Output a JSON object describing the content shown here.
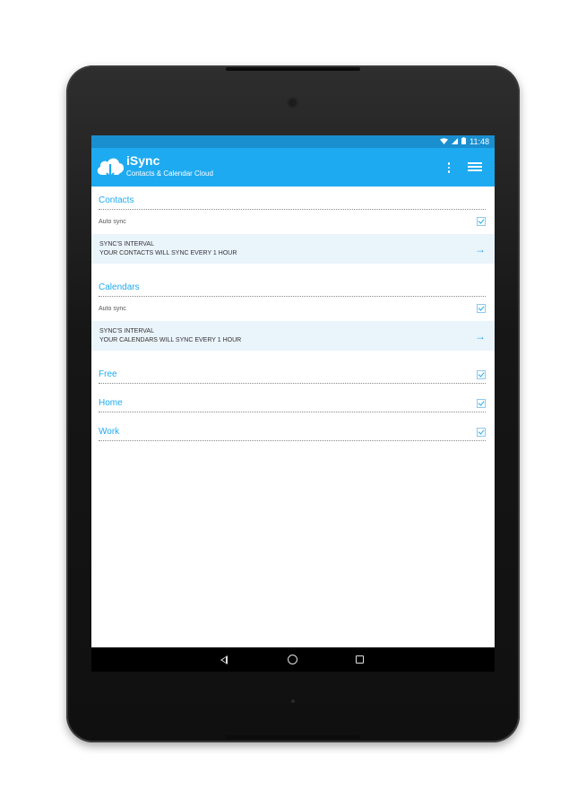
{
  "status_bar": {
    "time": "11:48",
    "icons": [
      "wifi-icon",
      "signal-icon",
      "battery-icon"
    ]
  },
  "app_bar": {
    "title": "iSync",
    "subtitle": "Contacts & Calendar Cloud",
    "logo_icon": "cloud-download-icon",
    "actions": [
      "overflow-menu-icon",
      "hamburger-menu-icon"
    ]
  },
  "contacts": {
    "header": "Contacts",
    "auto_sync_label": "Auto sync",
    "auto_sync_checked": true,
    "interval_title": "SYNC'S INTERVAL",
    "interval_description": "YOUR CONTACTS WILL SYNC EVERY 1 HOUR"
  },
  "calendars": {
    "header": "Calendars",
    "auto_sync_label": "Auto sync",
    "auto_sync_checked": true,
    "interval_title": "SYNC'S INTERVAL",
    "interval_description": "YOUR CALENDARS WILL SYNC EVERY 1 HOUR"
  },
  "calendar_list": [
    {
      "label": "Free",
      "checked": true
    },
    {
      "label": "Home",
      "checked": true
    },
    {
      "label": "Work",
      "checked": true
    }
  ],
  "nav_bar": [
    "back-icon",
    "home-icon",
    "recents-icon"
  ],
  "colors": {
    "accent": "#1eaaf1",
    "status_bar": "#1a8fd0",
    "interval_row_bg": "#eaf4fb",
    "device_bezel": "#161616"
  }
}
